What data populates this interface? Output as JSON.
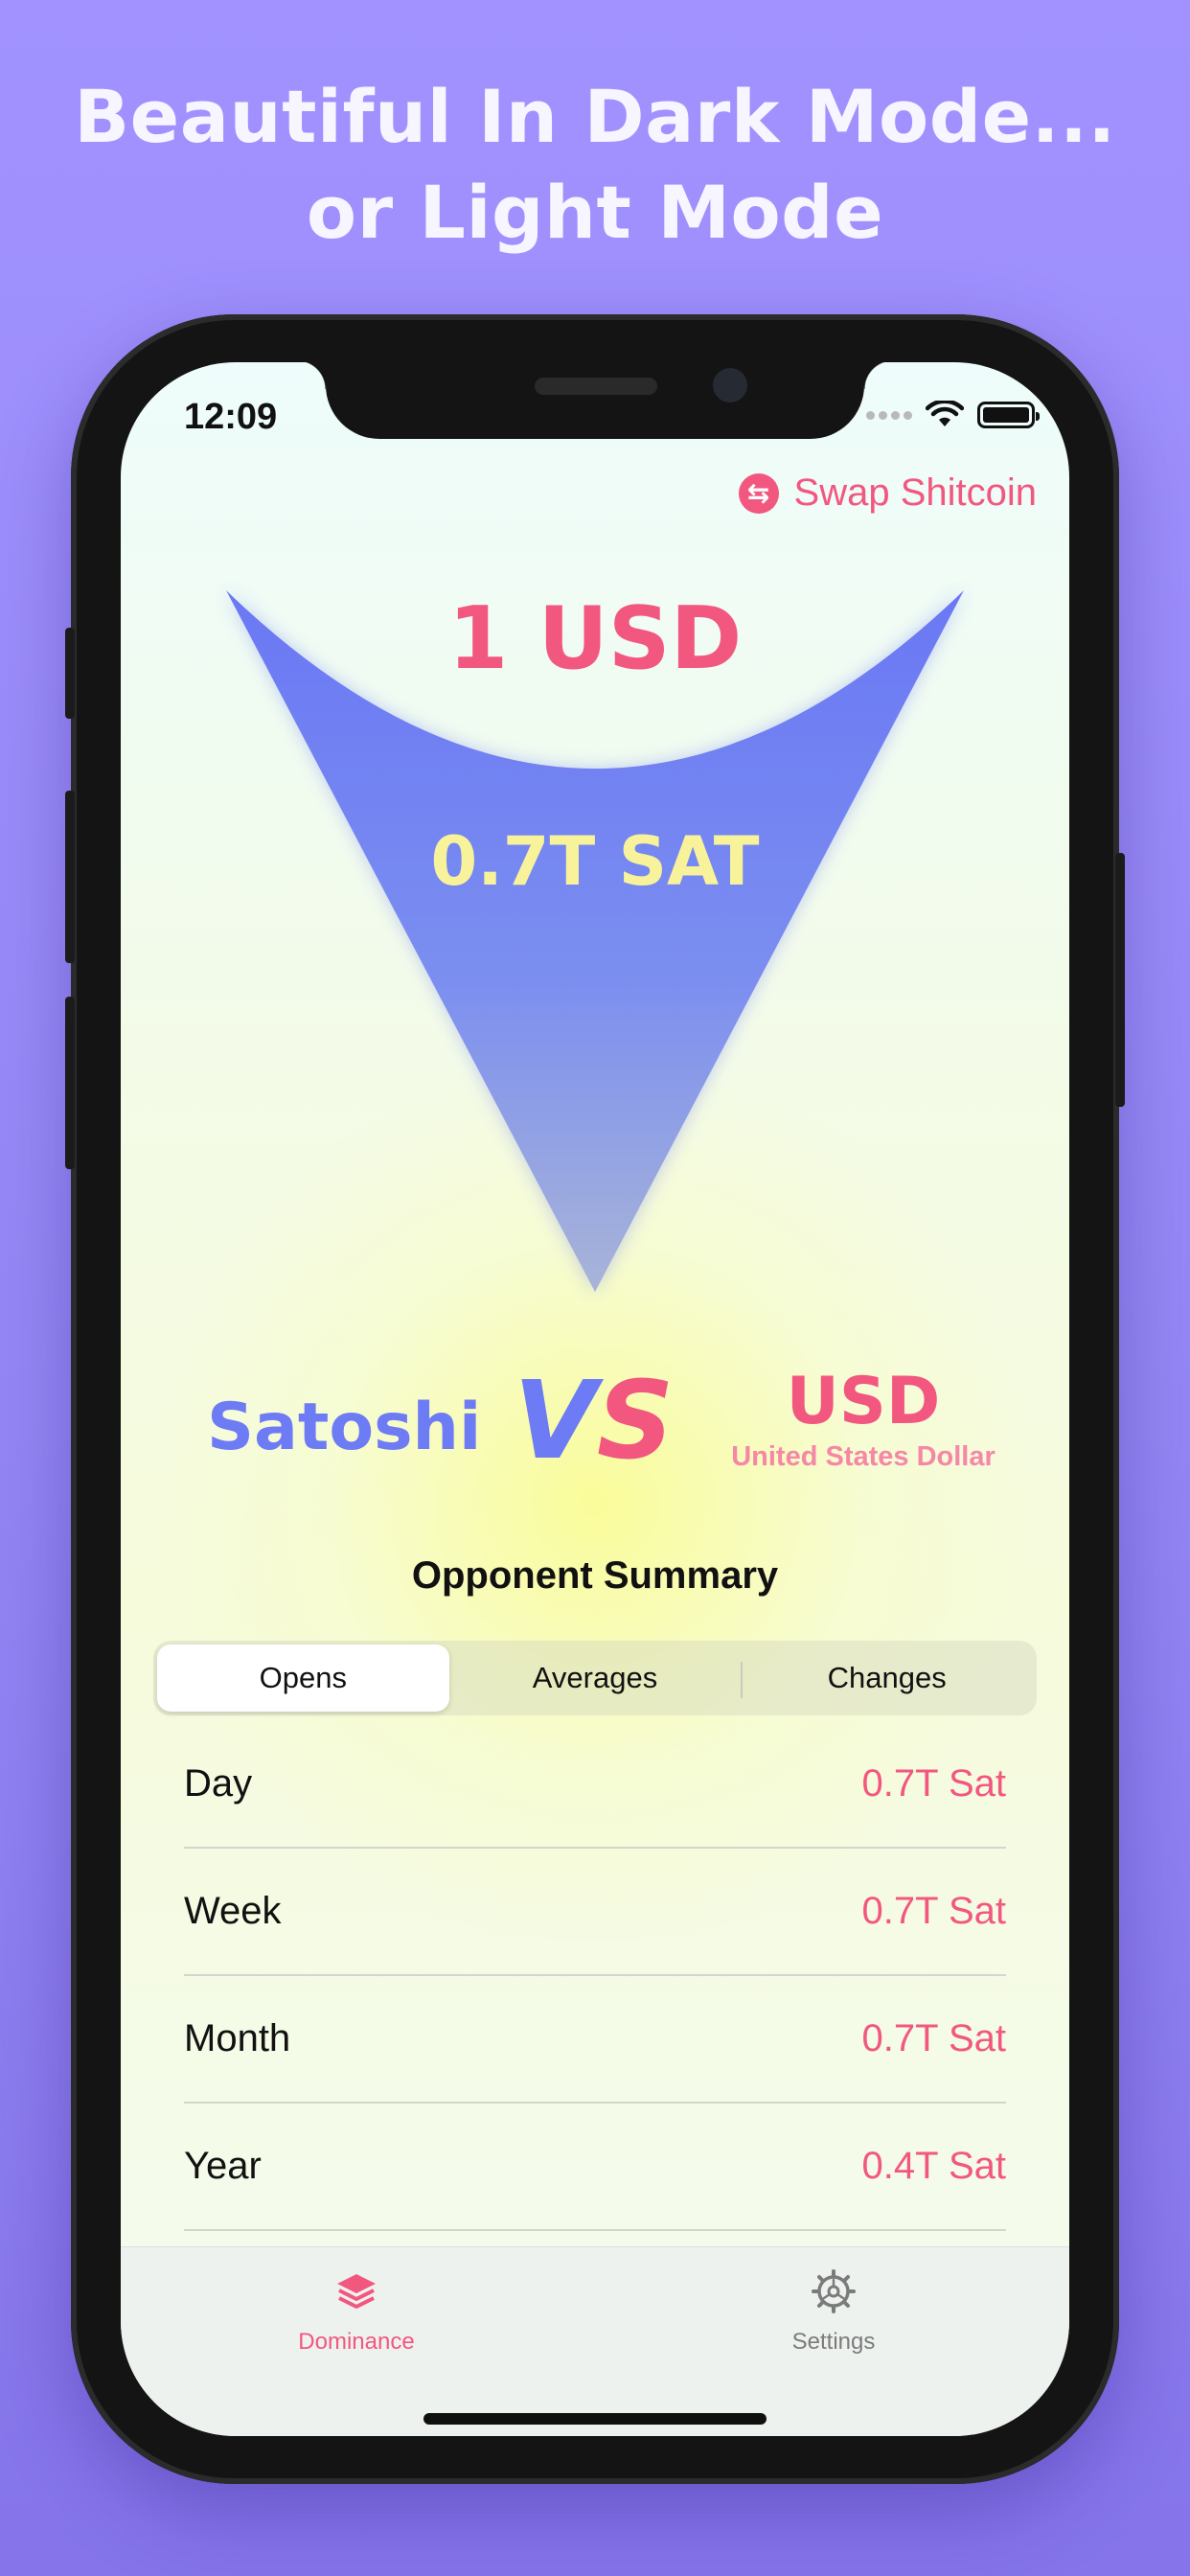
{
  "headline": {
    "line1": "Beautiful In Dark Mode...",
    "line2": "or Light Mode"
  },
  "status_bar": {
    "time": "12:09"
  },
  "header": {
    "swap_label": "Swap Shitcoin"
  },
  "hero": {
    "top_value": "1 USD",
    "mid_value": "0.7T SAT"
  },
  "versus": {
    "left_name": "Satoshi",
    "vs_v": "V",
    "vs_s": "S",
    "right_code": "USD",
    "right_name": "United States Dollar"
  },
  "summary": {
    "title": "Opponent Summary",
    "tabs": [
      "Opens",
      "Averages",
      "Changes"
    ],
    "selected_tab": "Opens",
    "rows": [
      {
        "label": "Day",
        "value": "0.7T Sat"
      },
      {
        "label": "Week",
        "value": "0.7T Sat"
      },
      {
        "label": "Month",
        "value": "0.7T Sat"
      },
      {
        "label": "Year",
        "value": "0.4T Sat"
      }
    ]
  },
  "tabbar": {
    "items": [
      {
        "label": "Dominance",
        "icon": "layers-icon",
        "selected": true
      },
      {
        "label": "Settings",
        "icon": "gear-icon",
        "selected": false
      }
    ]
  },
  "colors": {
    "accent_pink": "#f2577f",
    "accent_blue": "#6d7cf4",
    "highlight_yellow": "#f8f39a",
    "background_purple": "#9d90fb"
  }
}
